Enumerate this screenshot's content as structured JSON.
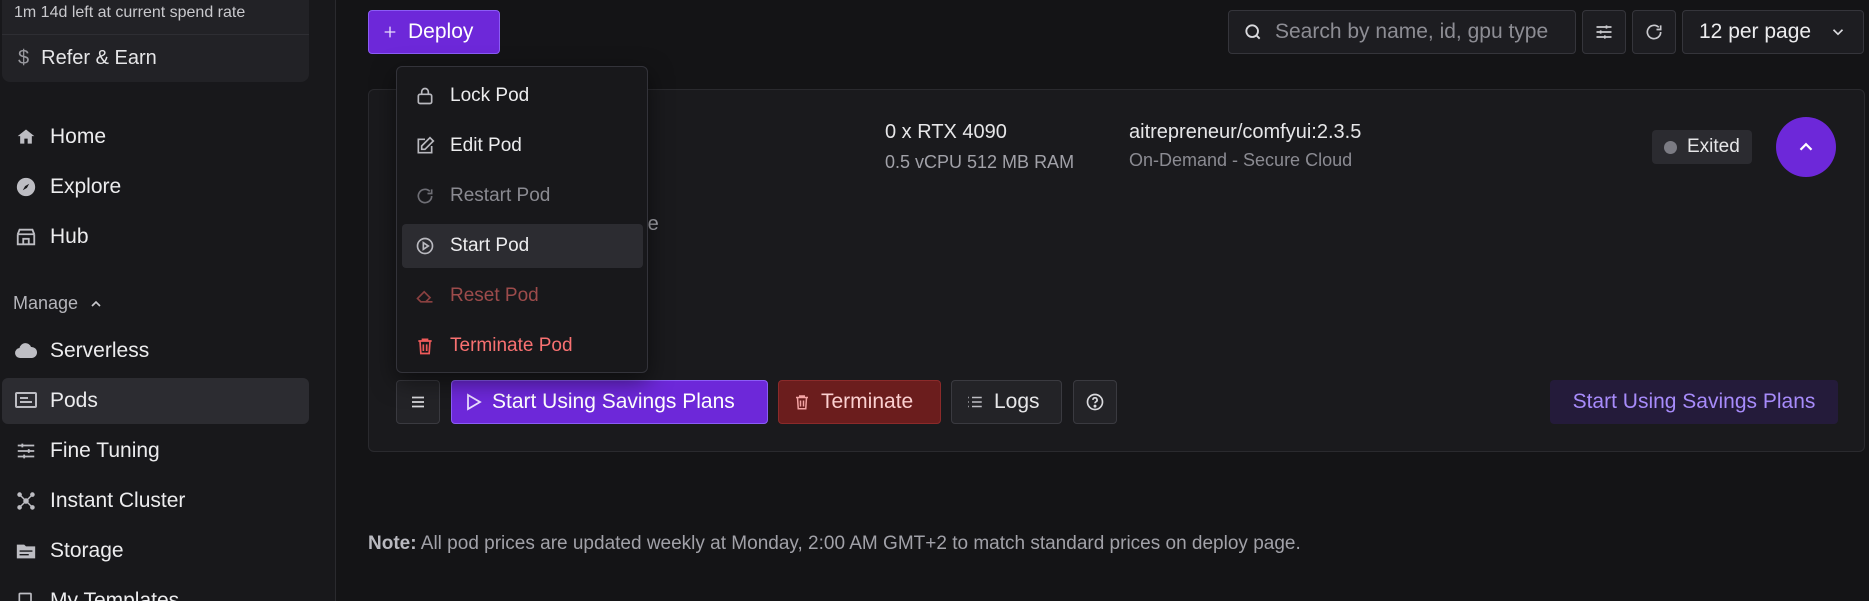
{
  "sidebar": {
    "credit_line": "1m 14d left at current spend rate",
    "refer_label": "Refer & Earn",
    "nav": [
      {
        "label": "Home",
        "icon": "home-icon"
      },
      {
        "label": "Explore",
        "icon": "compass-icon"
      },
      {
        "label": "Hub",
        "icon": "store-icon"
      }
    ],
    "manage_label": "Manage",
    "manage_items": [
      {
        "label": "Serverless",
        "icon": "cloud-icon"
      },
      {
        "label": "Pods",
        "icon": "server-icon",
        "active": true
      },
      {
        "label": "Fine Tuning",
        "icon": "sliders-icon"
      },
      {
        "label": "Instant Cluster",
        "icon": "cluster-icon"
      },
      {
        "label": "Storage",
        "icon": "folder-icon"
      },
      {
        "label": "My Templates",
        "icon": "template-icon"
      }
    ]
  },
  "toolbar": {
    "deploy_label": "Deploy",
    "search_placeholder": "Search by name, id, gpu type",
    "per_page_label": "12 per page"
  },
  "pod": {
    "gpu": "0 x RTX 4090",
    "resources": "0.5 vCPU 512 MB RAM",
    "image": "aitrepreneur/comfyui:2.3.5",
    "cloud": "On-Demand - Secure Cloud",
    "partial_text": "me",
    "status": "Exited",
    "status_color": "#7b7b83",
    "actions": {
      "savings_label": "Start Using Savings Plans",
      "terminate_label": "Terminate",
      "logs_label": "Logs",
      "savings_link_label": "Start Using Savings Plans"
    }
  },
  "menu": {
    "items": [
      {
        "label": "Lock Pod",
        "icon": "lock-icon"
      },
      {
        "label": "Edit Pod",
        "icon": "edit-icon"
      },
      {
        "label": "Restart Pod",
        "icon": "restart-icon"
      },
      {
        "label": "Start Pod",
        "icon": "play-circle-icon"
      },
      {
        "label": "Reset Pod",
        "icon": "eraser-icon"
      },
      {
        "label": "Terminate Pod",
        "icon": "trash-icon"
      }
    ]
  },
  "note": {
    "prefix": "Note:",
    "text": " All pod prices are updated weekly at Monday, 2:00 AM GMT+2 to match standard prices on deploy page."
  },
  "colors": {
    "accent": "#6d28d9",
    "danger": "#f87171",
    "background": "#141416"
  }
}
